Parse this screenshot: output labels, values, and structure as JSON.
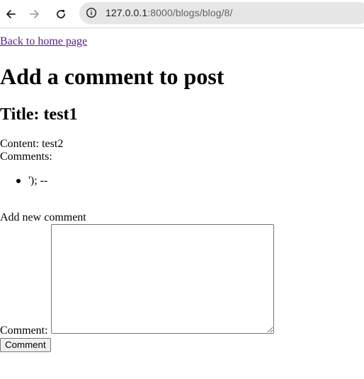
{
  "browser": {
    "url_host": "127.0.0.1",
    "url_rest": ":8000/blogs/blog/8/",
    "icons": {
      "back": "back-arrow-icon",
      "forward": "forward-arrow-icon",
      "reload": "reload-icon",
      "site_info": "site-info-icon"
    }
  },
  "page": {
    "back_link": "Back to home page",
    "heading": "Add a comment to post",
    "title_line": "Title: test1",
    "content_line": "Content: test2",
    "comments_label": "Comments:",
    "comments": [
      "'); --"
    ],
    "form": {
      "section_label": "Add new comment",
      "comment_label": "Comment:",
      "comment_value": "",
      "submit_label": "Comment"
    }
  }
}
